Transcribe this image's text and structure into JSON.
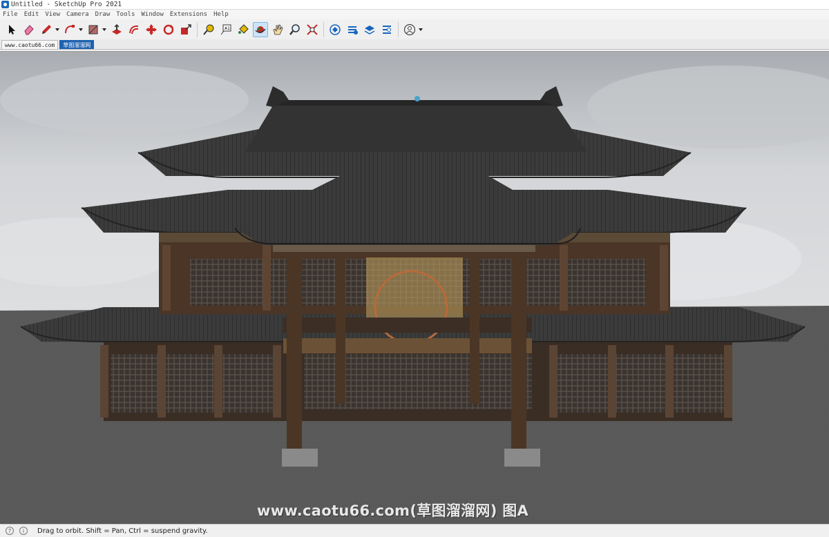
{
  "window": {
    "title": "Untitled - SketchUp Pro 2021"
  },
  "menu": [
    "File",
    "Edit",
    "View",
    "Camera",
    "Draw",
    "Tools",
    "Window",
    "Extensions",
    "Help"
  ],
  "toolbar": {
    "tools": [
      {
        "name": "select-tool",
        "icon": "arrow-icon"
      },
      {
        "name": "eraser-tool",
        "icon": "eraser-icon"
      },
      {
        "name": "line-tool",
        "icon": "pencil-icon",
        "dropdown": true
      },
      {
        "name": "arc-tool",
        "icon": "arc-icon",
        "dropdown": true
      },
      {
        "name": "rectangle-tool",
        "icon": "rectangle-icon",
        "dropdown": true
      },
      {
        "name": "push-pull-tool",
        "icon": "push-pull-icon"
      },
      {
        "name": "offset-tool",
        "icon": "offset-icon"
      },
      {
        "name": "move-tool",
        "icon": "move-icon"
      },
      {
        "name": "rotate-tool",
        "icon": "rotate-icon"
      },
      {
        "name": "scale-tool",
        "icon": "scale-icon"
      },
      {
        "name": "tape-measure-tool",
        "icon": "tape-icon"
      },
      {
        "name": "text-tool",
        "icon": "text-icon"
      },
      {
        "name": "paint-bucket-tool",
        "icon": "paint-bucket-icon"
      },
      {
        "name": "orbit-tool",
        "icon": "orbit-icon",
        "active": true
      },
      {
        "name": "pan-tool",
        "icon": "hand-icon"
      },
      {
        "name": "zoom-tool",
        "icon": "zoom-icon"
      },
      {
        "name": "zoom-extents-tool",
        "icon": "zoom-extents-icon"
      },
      {
        "name": "3d-warehouse-button",
        "icon": "warehouse-icon"
      },
      {
        "name": "extension-warehouse-button",
        "icon": "extension-warehouse-icon"
      },
      {
        "name": "layout-button",
        "icon": "layout-icon"
      },
      {
        "name": "extension-manager-button",
        "icon": "extension-manager-icon"
      },
      {
        "name": "account-button",
        "icon": "user-icon",
        "dropdown": true
      }
    ]
  },
  "tabs": [
    {
      "label": "www.caotu66.com",
      "selected": false
    },
    {
      "label": "草图溜溜网",
      "selected": true
    }
  ],
  "watermark": "www.caotu66.com(草图溜溜网) 图A",
  "status": {
    "text": "Drag to orbit. Shift = Pan, Ctrl = suspend gravity."
  },
  "colors": {
    "accent": "#1e62b0",
    "roof": "#3a3a3a",
    "wood": "#4a3526",
    "ground": "#555555",
    "sky": "#d8dadc"
  }
}
